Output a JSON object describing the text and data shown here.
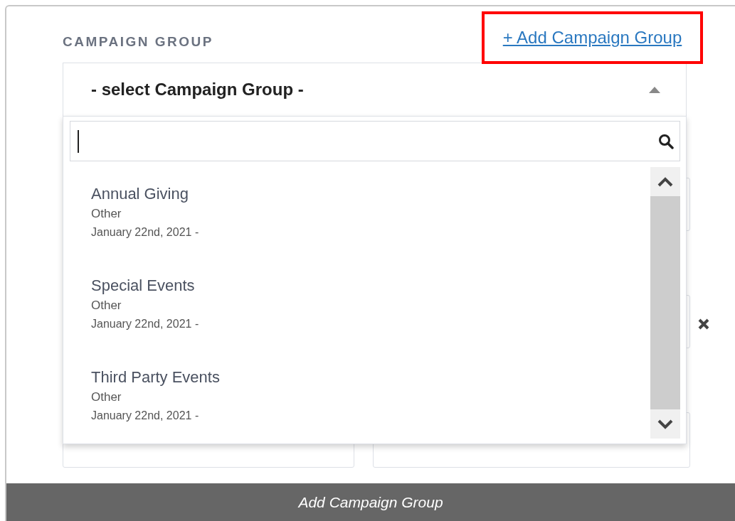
{
  "section_label": "CAMPAIGN GROUP",
  "add_link": "+ Add Campaign Group",
  "select": {
    "placeholder": "- select Campaign Group -",
    "expanded": true
  },
  "dropdown_items": [
    {
      "name": "Annual Giving",
      "type": "Other",
      "date": "January 22nd, 2021 -"
    },
    {
      "name": "Special Events",
      "type": "Other",
      "date": "January 22nd, 2021 -"
    },
    {
      "name": "Third Party Events",
      "type": "Other",
      "date": "January 22nd, 2021 -"
    }
  ],
  "caption": "Add Campaign Group"
}
